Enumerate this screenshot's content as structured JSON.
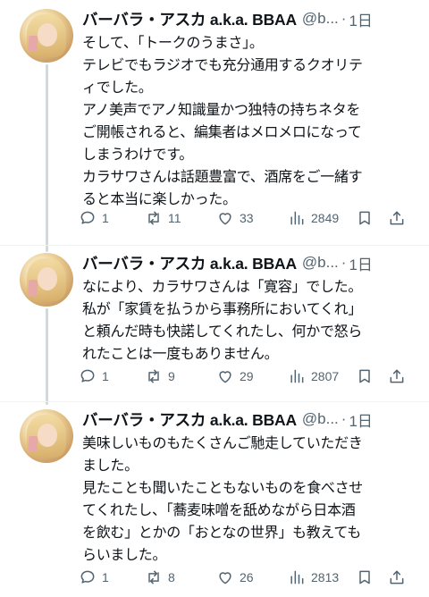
{
  "tweets": [
    {
      "author_name": "バーバラ・アスカ a.k.a. BBAA",
      "handle": "@b...",
      "separator": "·",
      "time": "1日",
      "lines": [
        "そして、「トークのうまさ」。",
        "テレビでもラジオでも充分通用するクオリテ",
        "ィでした。",
        "アノ美声でアノ知識量かつ独特の持ちネタを",
        "ご開帳されると、編集者はメロメロになって",
        "しまうわけです。",
        "カラサワさんは話題豊富で、酒席をご一緒す",
        "ると本当に楽しかった。"
      ],
      "replies": "1",
      "retweets": "11",
      "likes": "33",
      "views": "2849"
    },
    {
      "author_name": "バーバラ・アスカ a.k.a. BBAA",
      "handle": "@b...",
      "separator": "·",
      "time": "1日",
      "lines": [
        "なにより、カラサワさんは「寛容」でした。",
        "私が「家賃を払うから事務所においてくれ」",
        "と頼んだ時も快諾してくれたし、何かで怒ら",
        "れたことは一度もありません。"
      ],
      "replies": "1",
      "retweets": "9",
      "likes": "29",
      "views": "2807"
    },
    {
      "author_name": "バーバラ・アスカ a.k.a. BBAA",
      "handle": "@b...",
      "separator": "·",
      "time": "1日",
      "lines": [
        "美味しいものもたくさんご馳走していただき",
        "ました。",
        "見たことも聞いたこともないものを食べさせ",
        "てくれたし、「蕎麦味噌を舐めながら日本酒",
        "を飲む」とかの「おとなの世界」も教えても",
        "らいました。"
      ],
      "replies": "1",
      "retweets": "8",
      "likes": "26",
      "views": "2813"
    }
  ],
  "icons": {
    "reply": "speech-bubble",
    "retweet": "retweet-arrows",
    "like": "heart-outline",
    "views": "bar-chart",
    "bookmark": "bookmark",
    "share": "share-up-arrow"
  },
  "colors": {
    "text": "#0f1419",
    "secondary": "#536471",
    "thread_line": "#cfd9de"
  }
}
